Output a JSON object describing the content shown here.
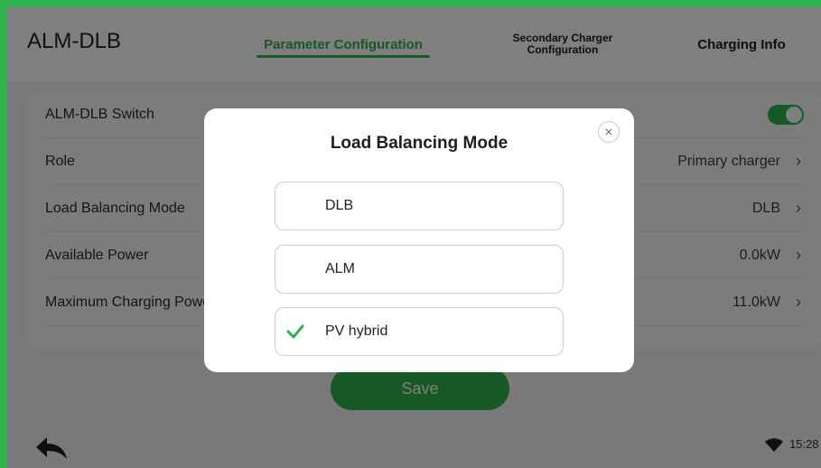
{
  "header": {
    "title": "ALM-DLB",
    "tabs": [
      {
        "label": "Parameter Configuration"
      },
      {
        "label": "Secondary Charger\nConfiguration"
      },
      {
        "label": "Charging Info"
      }
    ]
  },
  "settings": {
    "rows": [
      {
        "label": "ALM-DLB Switch",
        "value": ""
      },
      {
        "label": "Role",
        "value": "Primary charger"
      },
      {
        "label": "Load Balancing Mode",
        "value": "DLB"
      },
      {
        "label": "Available Power",
        "value": "0.0kW"
      },
      {
        "label": "Maximum Charging Power",
        "value": "11.0kW"
      }
    ],
    "switch_on": true
  },
  "save_label": "Save",
  "status": {
    "time": "15:28"
  },
  "dialog": {
    "title": "Load Balancing Mode",
    "close_glyph": "×",
    "options": [
      {
        "label": "DLB",
        "selected": false
      },
      {
        "label": "ALM",
        "selected": false
      },
      {
        "label": "PV hybrid",
        "selected": true
      }
    ]
  },
  "colors": {
    "accent": "#2eb34b"
  },
  "icons": [
    "back-arrow-icon",
    "wifi-icon",
    "chevron-right-icon",
    "checkmark-icon",
    "close-icon"
  ]
}
